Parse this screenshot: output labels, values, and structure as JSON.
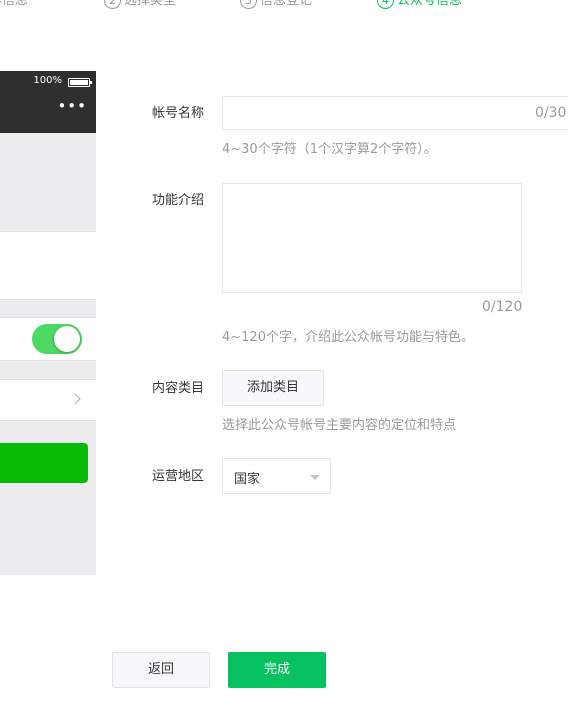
{
  "stepper": {
    "steps": [
      {
        "number": "",
        "label": "基本信息",
        "active": false
      },
      {
        "number": "2",
        "label": "选择类型",
        "active": false
      },
      {
        "number": "3",
        "label": "信息登记",
        "active": false
      },
      {
        "number": "4",
        "label": "公众号信息",
        "active": true
      }
    ],
    "active_color": "#07c160"
  },
  "phone_preview": {
    "battery_text": "100%",
    "more_icon": "more-dots-icon",
    "toggle_on": true,
    "toggle_color": "#4cd964",
    "button_color": "#09bb07"
  },
  "form": {
    "account_name": {
      "label": "帐号名称",
      "value": "",
      "counter": "0/30",
      "hint": "4~30个字符（1个汉字算2个字符）。"
    },
    "intro": {
      "label": "功能介绍",
      "value": "",
      "counter": "0/120",
      "hint": "4~120个字，介绍此公众帐号功能与特色。"
    },
    "category": {
      "label": "内容类目",
      "button_label": "添加类目",
      "hint": "选择此公众号帐号主要内容的定位和特点"
    },
    "region": {
      "label": "运营地区",
      "selected": "国家"
    }
  },
  "footer": {
    "back_label": "返回",
    "done_label": "完成",
    "done_color": "#07c160"
  }
}
